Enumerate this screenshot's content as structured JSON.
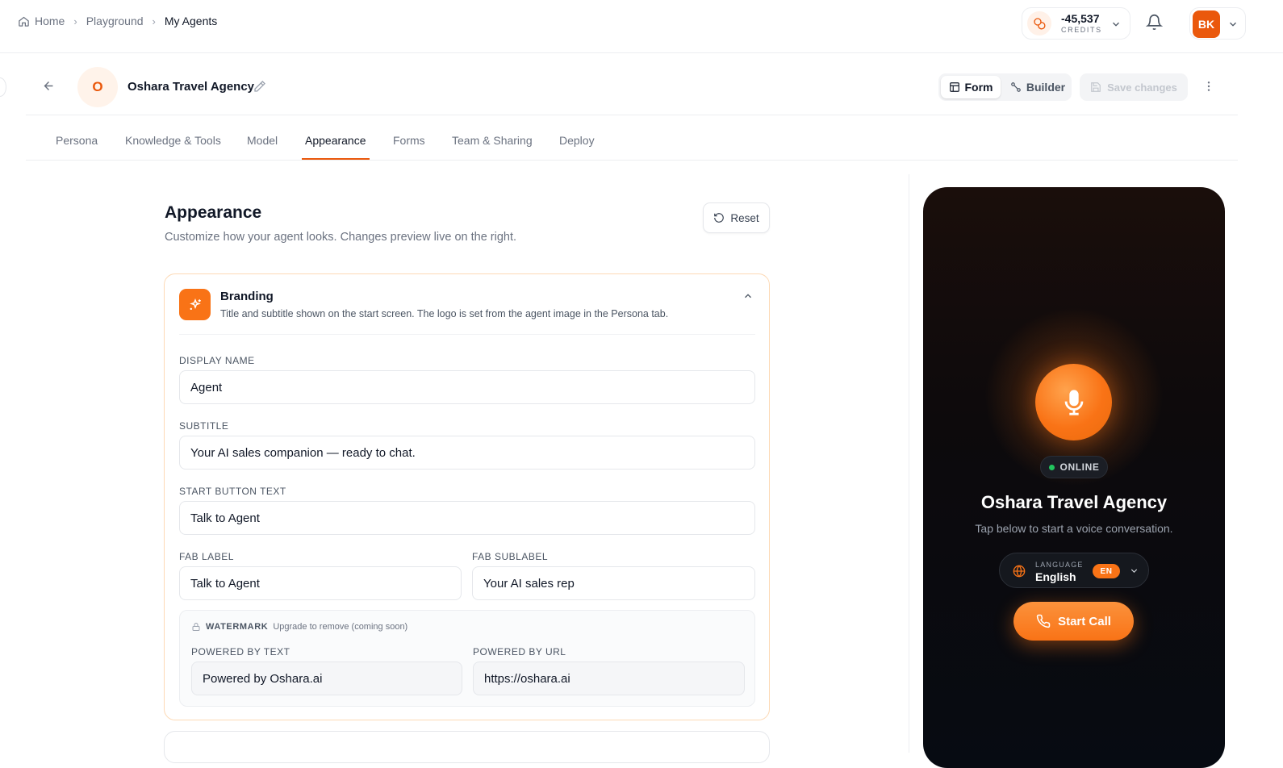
{
  "breadcrumb": {
    "home": "Home",
    "playground": "Playground",
    "current": "My Agents"
  },
  "credits": {
    "value": "-45,537",
    "label": "CREDITS"
  },
  "user": {
    "initials": "BK"
  },
  "agent": {
    "initial": "O",
    "name": "Oshara Travel Agency"
  },
  "modes": {
    "form": "Form",
    "builder": "Builder"
  },
  "save_label": "Save changes",
  "tabs": [
    "Persona",
    "Knowledge & Tools",
    "Model",
    "Appearance",
    "Forms",
    "Team & Sharing",
    "Deploy"
  ],
  "active_tab": "Appearance",
  "section": {
    "title": "Appearance",
    "subtitle": "Customize how your agent looks. Changes preview live on the right.",
    "reset": "Reset"
  },
  "branding": {
    "title": "Branding",
    "description": "Title and subtitle shown on the start screen. The logo is set from the agent image in the Persona tab.",
    "display_name_label": "DISPLAY NAME",
    "display_name": "Agent",
    "subtitle_label": "SUBTITLE",
    "subtitle": "Your AI sales companion — ready to chat.",
    "start_button_label": "START BUTTON TEXT",
    "start_button": "Talk to Agent",
    "fab_label_label": "FAB LABEL",
    "fab_label": "Talk to Agent",
    "fab_sublabel_label": "FAB SUBLABEL",
    "fab_sublabel": "Your AI sales rep",
    "watermark_title": "WATERMARK",
    "watermark_note": "Upgrade to remove (coming soon)",
    "powered_text_label": "POWERED BY TEXT",
    "powered_text": "Powered by Oshara.ai",
    "powered_url_label": "POWERED BY URL",
    "powered_url": "https://oshara.ai"
  },
  "preview": {
    "status": "ONLINE",
    "title": "Oshara Travel Agency",
    "subtitle": "Tap below to start a voice conversation.",
    "language_label": "LANGUAGE",
    "language": "English",
    "language_code": "EN",
    "start_call": "Start Call"
  },
  "colors": {
    "accent": "#f97316",
    "accent_dark": "#ea580c",
    "online": "#22c55e"
  },
  "icons": [
    "home-icon",
    "chevron-right-icon",
    "coins-icon",
    "chevron-down-icon",
    "bell-icon",
    "arrow-left-icon",
    "pencil-icon",
    "layout-icon",
    "workflow-icon",
    "save-icon",
    "more-vertical-icon",
    "reset-icon",
    "sparkles-icon",
    "chevron-up-icon",
    "lock-icon",
    "mic-icon",
    "globe-icon",
    "phone-icon"
  ]
}
